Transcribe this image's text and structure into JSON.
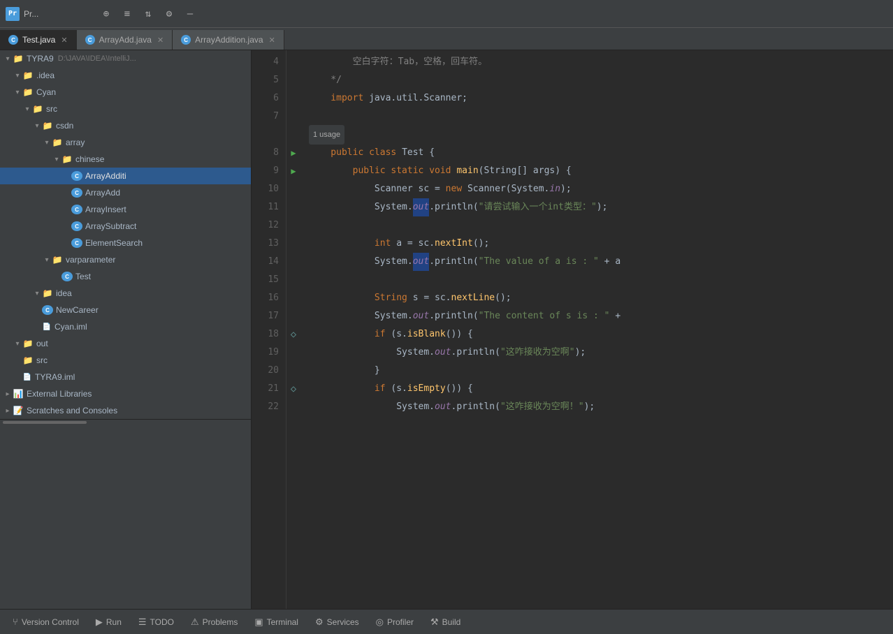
{
  "titleBar": {
    "icon": "Pr",
    "title": "Pr...",
    "windowPath": "D:\\JAVA\\IDEA\\IntelliJ..."
  },
  "tabs": [
    {
      "label": "Test.java",
      "active": true,
      "icon": "C"
    },
    {
      "label": "ArrayAdd.java",
      "active": false,
      "icon": "C"
    },
    {
      "label": "ArrayAddition.java",
      "active": false,
      "icon": "C"
    }
  ],
  "sidebar": {
    "title": "Project",
    "tree": [
      {
        "level": 0,
        "arrow": "open",
        "icon": "folder",
        "label": "TYRA9",
        "suffix": "D:\\JAVA\\IDEA\\Intelli",
        "color": "#a9b7c6"
      },
      {
        "level": 1,
        "arrow": "open",
        "icon": "folder-dot",
        "label": ".idea",
        "color": "#a9b7c6"
      },
      {
        "level": 1,
        "arrow": "open",
        "icon": "folder-cyan",
        "label": "Cyan",
        "color": "#a9b7c6"
      },
      {
        "level": 2,
        "arrow": "open",
        "icon": "folder",
        "label": "src",
        "color": "#a9b7c6"
      },
      {
        "level": 3,
        "arrow": "open",
        "icon": "folder",
        "label": "csdn",
        "color": "#a9b7c6"
      },
      {
        "level": 4,
        "arrow": "open",
        "icon": "folder",
        "label": "array",
        "color": "#a9b7c6"
      },
      {
        "level": 5,
        "arrow": "open",
        "icon": "folder",
        "label": "chinese",
        "color": "#a9b7c6"
      },
      {
        "level": 6,
        "arrow": "empty",
        "icon": "java",
        "label": "ArrayAdditi",
        "selected": true,
        "color": "#e0e0e0"
      },
      {
        "level": 6,
        "arrow": "empty",
        "icon": "java",
        "label": "ArrayAdd",
        "color": "#a9b7c6"
      },
      {
        "level": 6,
        "arrow": "empty",
        "icon": "java",
        "label": "ArrayInsert",
        "color": "#a9b7c6"
      },
      {
        "level": 6,
        "arrow": "empty",
        "icon": "java",
        "label": "ArraySubtract",
        "color": "#a9b7c6"
      },
      {
        "level": 6,
        "arrow": "empty",
        "icon": "java",
        "label": "ElementSearch",
        "color": "#a9b7c6"
      },
      {
        "level": 4,
        "arrow": "open",
        "icon": "folder",
        "label": "varparameter",
        "color": "#a9b7c6"
      },
      {
        "level": 5,
        "arrow": "empty",
        "icon": "java",
        "label": "Test",
        "color": "#a9b7c6"
      },
      {
        "level": 3,
        "arrow": "open",
        "icon": "folder-dot",
        "label": "idea",
        "color": "#a9b7c6"
      },
      {
        "level": 3,
        "arrow": "empty",
        "icon": "java",
        "label": "NewCareer",
        "color": "#a9b7c6"
      },
      {
        "level": 3,
        "arrow": "empty",
        "icon": "iml",
        "label": "Cyan.iml",
        "color": "#a9b7c6"
      },
      {
        "level": 1,
        "arrow": "open",
        "icon": "folder-orange",
        "label": "out",
        "color": "#a9b7c6"
      },
      {
        "level": 1,
        "arrow": "empty",
        "icon": "folder",
        "label": "src",
        "color": "#a9b7c6"
      },
      {
        "level": 1,
        "arrow": "empty",
        "icon": "iml",
        "label": "TYRA9.iml",
        "color": "#a9b7c6"
      },
      {
        "level": 0,
        "arrow": "closed",
        "icon": "folder-lib",
        "label": "External Libraries",
        "color": "#a9b7c6"
      },
      {
        "level": 0,
        "arrow": "closed",
        "icon": "folder-sc",
        "label": "Scratches and Consoles",
        "color": "#a9b7c6"
      }
    ]
  },
  "codeLines": [
    {
      "num": 4,
      "gutter": "",
      "indent": 8,
      "tokens": [
        {
          "t": "空白字符：Tab，空格，回车符。",
          "c": "cm"
        }
      ]
    },
    {
      "num": 5,
      "gutter": "",
      "indent": 4,
      "tokens": [
        {
          "t": "*/",
          "c": "cm"
        }
      ]
    },
    {
      "num": 6,
      "gutter": "",
      "indent": 4,
      "tokens": [
        {
          "t": "import ",
          "c": "kw"
        },
        {
          "t": "java.util.Scanner",
          "c": ""
        },
        {
          "t": ";",
          "c": ""
        }
      ]
    },
    {
      "num": 7,
      "gutter": "",
      "indent": 0,
      "tokens": []
    },
    {
      "num": "1 usage",
      "gutter": "",
      "indent": 0,
      "tokens": [
        {
          "t": "1 usage",
          "c": "usage"
        }
      ]
    },
    {
      "num": 8,
      "gutter": "run",
      "indent": 4,
      "tokens": [
        {
          "t": "public ",
          "c": "kw"
        },
        {
          "t": "class ",
          "c": "kw"
        },
        {
          "t": "Test ",
          "c": ""
        },
        {
          "t": "{",
          "c": ""
        }
      ]
    },
    {
      "num": 9,
      "gutter": "run",
      "indent": 8,
      "tokens": [
        {
          "t": "public ",
          "c": "kw"
        },
        {
          "t": "static ",
          "c": "kw"
        },
        {
          "t": "void ",
          "c": "kw"
        },
        {
          "t": "main",
          "c": "fn"
        },
        {
          "t": "(String[] args) {",
          "c": ""
        }
      ]
    },
    {
      "num": 10,
      "gutter": "",
      "indent": 12,
      "tokens": [
        {
          "t": "Scanner ",
          "c": ""
        },
        {
          "t": "sc = ",
          "c": ""
        },
        {
          "t": "new ",
          "c": "kw"
        },
        {
          "t": "Scanner(System.",
          "c": ""
        },
        {
          "t": "in",
          "c": "it"
        },
        {
          "t": ");",
          "c": ""
        }
      ]
    },
    {
      "num": 11,
      "gutter": "",
      "indent": 12,
      "tokens": [
        {
          "t": "System.",
          "c": ""
        },
        {
          "t": "out",
          "c": "it hi"
        },
        {
          "t": ".println(",
          "c": ""
        },
        {
          "t": "\"请尝试输入一个int类型：\"",
          "c": "str"
        },
        {
          "t": ");",
          "c": ""
        }
      ]
    },
    {
      "num": 12,
      "gutter": "",
      "indent": 0,
      "tokens": []
    },
    {
      "num": 13,
      "gutter": "",
      "indent": 12,
      "tokens": [
        {
          "t": "int ",
          "c": "kw"
        },
        {
          "t": "a = sc.",
          "c": ""
        },
        {
          "t": "nextInt",
          "c": "fn"
        },
        {
          "t": "();",
          "c": ""
        }
      ]
    },
    {
      "num": 14,
      "gutter": "",
      "indent": 12,
      "tokens": [
        {
          "t": "System.",
          "c": ""
        },
        {
          "t": "out",
          "c": "it hi"
        },
        {
          "t": ".println(",
          "c": ""
        },
        {
          "t": "\"The value of a is : \" + a",
          "c": "str"
        }
      ]
    },
    {
      "num": 15,
      "gutter": "",
      "indent": 0,
      "tokens": []
    },
    {
      "num": 16,
      "gutter": "",
      "indent": 12,
      "tokens": [
        {
          "t": "String ",
          "c": "kw"
        },
        {
          "t": "s = sc.",
          "c": ""
        },
        {
          "t": "nextLine",
          "c": "fn"
        },
        {
          "t": "();",
          "c": ""
        }
      ]
    },
    {
      "num": 17,
      "gutter": "",
      "indent": 12,
      "tokens": [
        {
          "t": "System.",
          "c": ""
        },
        {
          "t": "out",
          "c": "it"
        },
        {
          "t": ".println(",
          "c": ""
        },
        {
          "t": "\"The content of s is : \" +",
          "c": "str"
        }
      ]
    },
    {
      "num": 18,
      "gutter": "fold",
      "indent": 12,
      "tokens": [
        {
          "t": "if ",
          "c": "kw"
        },
        {
          "t": "(s.",
          "c": ""
        },
        {
          "t": "isBlank",
          "c": "fn"
        },
        {
          "t": "()) {",
          "c": ""
        }
      ]
    },
    {
      "num": 19,
      "gutter": "",
      "indent": 16,
      "tokens": [
        {
          "t": "System.",
          "c": ""
        },
        {
          "t": "out",
          "c": "it"
        },
        {
          "t": ".println(",
          "c": ""
        },
        {
          "t": "\"这咋接收为空啊\"",
          "c": "str"
        },
        {
          "t": ");",
          "c": ""
        }
      ]
    },
    {
      "num": 20,
      "gutter": "",
      "indent": 12,
      "tokens": [
        {
          "t": "}",
          "c": ""
        }
      ]
    },
    {
      "num": 21,
      "gutter": "fold",
      "indent": 12,
      "tokens": [
        {
          "t": "if ",
          "c": "kw"
        },
        {
          "t": "(s.",
          "c": ""
        },
        {
          "t": "isEmpty",
          "c": "fn"
        },
        {
          "t": "()) {",
          "c": ""
        }
      ]
    },
    {
      "num": 22,
      "gutter": "",
      "indent": 16,
      "tokens": [
        {
          "t": "System.",
          "c": ""
        },
        {
          "t": "out",
          "c": "it"
        },
        {
          "t": ".println(",
          "c": ""
        },
        {
          "t": "\"这咋接收为空啊！\"",
          "c": "str"
        },
        {
          "t": ");",
          "c": ""
        }
      ]
    }
  ],
  "bottomTabs": [
    {
      "label": "Version Control",
      "icon": "⑂",
      "active": false
    },
    {
      "label": "Run",
      "icon": "▶",
      "active": false
    },
    {
      "label": "TODO",
      "icon": "☰",
      "active": false
    },
    {
      "label": "Problems",
      "icon": "⚠",
      "active": false
    },
    {
      "label": "Terminal",
      "icon": ">_",
      "active": false
    },
    {
      "label": "Services",
      "icon": "⚙",
      "active": false
    },
    {
      "label": "Profiler",
      "icon": "◎",
      "active": false
    },
    {
      "label": "Build",
      "icon": "⚒",
      "active": false
    }
  ]
}
